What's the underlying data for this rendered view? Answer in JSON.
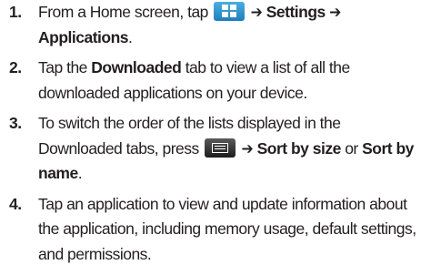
{
  "steps": [
    {
      "number": "1.",
      "text_before": "From a Home screen, tap",
      "icon": "apps-icon",
      "arrow1": "➔",
      "settings": "Settings",
      "arrow2": "➔",
      "applications": "Applications",
      "period": "."
    },
    {
      "number": "2.",
      "text_before": "Tap the",
      "downloaded": "Downloaded",
      "text_after": "tab to view a list of all the downloaded applications on your device."
    },
    {
      "number": "3.",
      "text_before": "To switch the order of the lists displayed in the Downloaded tabs, press",
      "icon": "menu-icon",
      "arrow": "➔",
      "sort_size": "Sort by size",
      "or": "or",
      "sort_name": "Sort by name",
      "period": "."
    },
    {
      "number": "4.",
      "text": "Tap an application to view and update information about the application, including memory usage, default settings, and permissions."
    }
  ]
}
